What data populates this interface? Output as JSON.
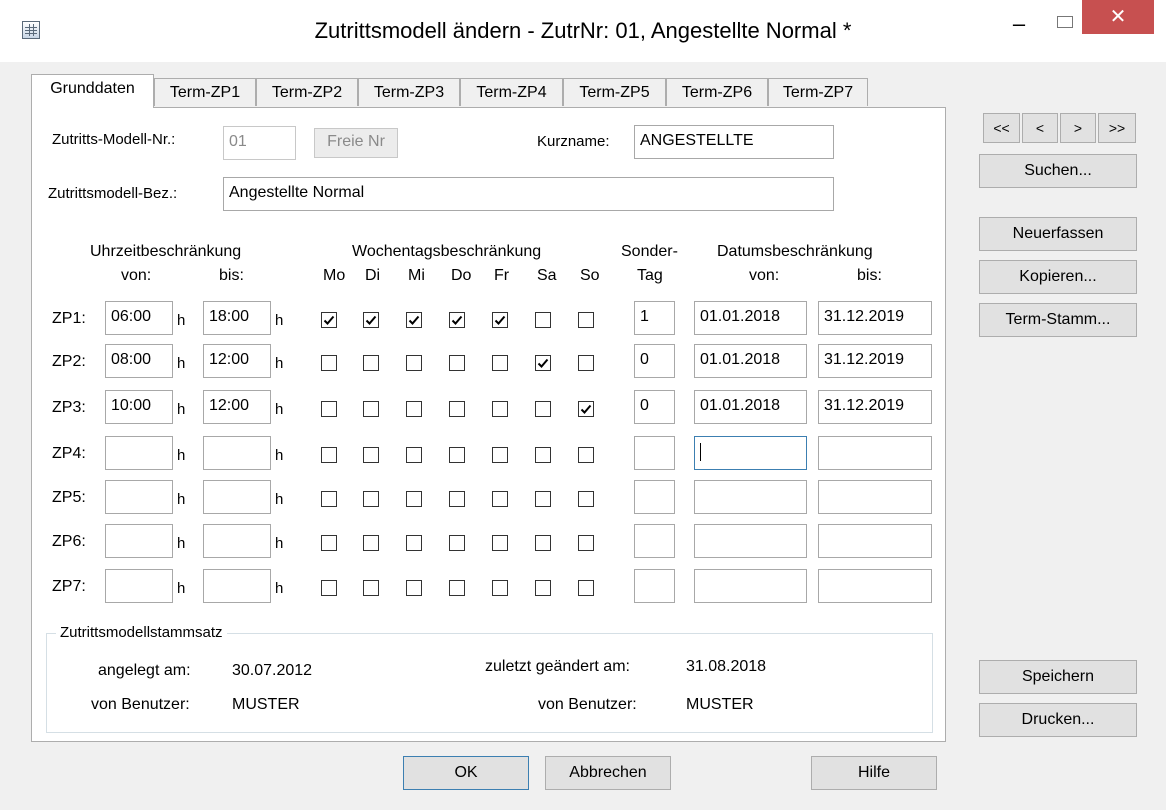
{
  "window": {
    "title": "Zutrittsmodell ändern - ZutrNr: 01, Angestellte Normal *"
  },
  "tabs": [
    "Grunddaten",
    "Term-ZP1",
    "Term-ZP2",
    "Term-ZP3",
    "Term-ZP4",
    "Term-ZP5",
    "Term-ZP6",
    "Term-ZP7"
  ],
  "form": {
    "model_nr_label": "Zutritts-Modell-Nr.:",
    "model_nr_value": "01",
    "free_nr_button": "Freie Nr",
    "kurzname_label": "Kurzname:",
    "kurzname_value": "ANGESTELLTE",
    "bez_label": "Zutrittsmodell-Bez.:",
    "bez_value": "Angestellte Normal"
  },
  "headers": {
    "time": "Uhrzeitbeschränkung",
    "time_from": "von:",
    "time_to": "bis:",
    "weekday": "Wochentagsbeschränkung",
    "days": [
      "Mo",
      "Di",
      "Mi",
      "Do",
      "Fr",
      "Sa",
      "So"
    ],
    "special_1": "Sonder-",
    "special_2": "Tag",
    "date": "Datumsbeschränkung",
    "date_from": "von:",
    "date_to": "bis:",
    "hour_unit": "h"
  },
  "rows": [
    {
      "label": "ZP1:",
      "from": "06:00",
      "to": "18:00",
      "days": [
        true,
        true,
        true,
        true,
        true,
        false,
        false
      ],
      "special": "1",
      "date_from": "01.01.2018",
      "date_to": "31.12.2019"
    },
    {
      "label": "ZP2:",
      "from": "08:00",
      "to": "12:00",
      "days": [
        false,
        false,
        false,
        false,
        false,
        true,
        false
      ],
      "special": "0",
      "date_from": "01.01.2018",
      "date_to": "31.12.2019"
    },
    {
      "label": "ZP3:",
      "from": "10:00",
      "to": "12:00",
      "days": [
        false,
        false,
        false,
        false,
        false,
        false,
        true
      ],
      "special": "0",
      "date_from": "01.01.2018",
      "date_to": "31.12.2019"
    },
    {
      "label": "ZP4:",
      "from": "",
      "to": "",
      "days": [
        false,
        false,
        false,
        false,
        false,
        false,
        false
      ],
      "special": "",
      "date_from": "",
      "date_to": ""
    },
    {
      "label": "ZP5:",
      "from": "",
      "to": "",
      "days": [
        false,
        false,
        false,
        false,
        false,
        false,
        false
      ],
      "special": "",
      "date_from": "",
      "date_to": ""
    },
    {
      "label": "ZP6:",
      "from": "",
      "to": "",
      "days": [
        false,
        false,
        false,
        false,
        false,
        false,
        false
      ],
      "special": "",
      "date_from": "",
      "date_to": ""
    },
    {
      "label": "ZP7:",
      "from": "",
      "to": "",
      "days": [
        false,
        false,
        false,
        false,
        false,
        false,
        false
      ],
      "special": "",
      "date_from": "",
      "date_to": ""
    }
  ],
  "record": {
    "title": "Zutrittsmodellstammsatz",
    "created_label": "angelegt am:",
    "created_value": "30.07.2012",
    "created_by_label": "von Benutzer:",
    "created_by_value": "MUSTER",
    "changed_label": "zuletzt geändert am:",
    "changed_value": "31.08.2018",
    "changed_by_label": "von Benutzer:",
    "changed_by_value": "MUSTER"
  },
  "nav": {
    "first": "<<",
    "prev": "<",
    "next": ">",
    "last": ">>"
  },
  "side_buttons": {
    "search": "Suchen...",
    "new": "Neuerfassen",
    "copy": "Kopieren...",
    "term": "Term-Stamm...",
    "save": "Speichern",
    "print": "Drucken..."
  },
  "bottom_buttons": {
    "ok": "OK",
    "cancel": "Abbrechen",
    "help": "Hilfe"
  }
}
